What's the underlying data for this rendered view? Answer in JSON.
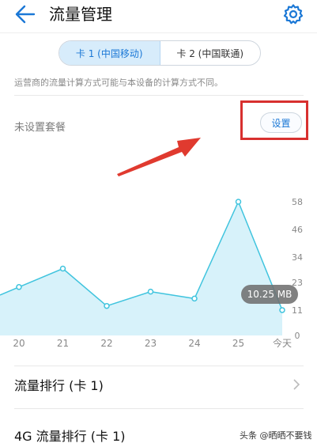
{
  "header": {
    "title": "流量管理"
  },
  "tabs": [
    {
      "label": "卡 1 (中国移动)",
      "selected": true
    },
    {
      "label": "卡 2 (中国联通)",
      "selected": false
    }
  ],
  "note": "运营商的流量计算方式可能与本设备的计算方式不同。",
  "plan": {
    "label": "未设置套餐",
    "button_label": "设置"
  },
  "chart_data": {
    "type": "area",
    "categories": [
      "20",
      "21",
      "22",
      "23",
      "24",
      "25",
      "今天"
    ],
    "values": [
      21,
      29,
      12.8,
      19,
      16,
      58,
      11
    ],
    "yticks": [
      "58",
      "46",
      "34",
      "23",
      "11",
      "0"
    ],
    "ylim": [
      0,
      58
    ],
    "tooltip": "10.25 MB",
    "colors": {
      "line": "#40c4de",
      "fill": "#c9eef8"
    }
  },
  "list": [
    {
      "label": "流量排行 (卡 1)"
    },
    {
      "label": "4G 流量排行 (卡 1)"
    }
  ],
  "watermark": "头条 @晒晒不要钱",
  "colors": {
    "accent": "#1b78d6",
    "highlight": "#d8302f"
  }
}
